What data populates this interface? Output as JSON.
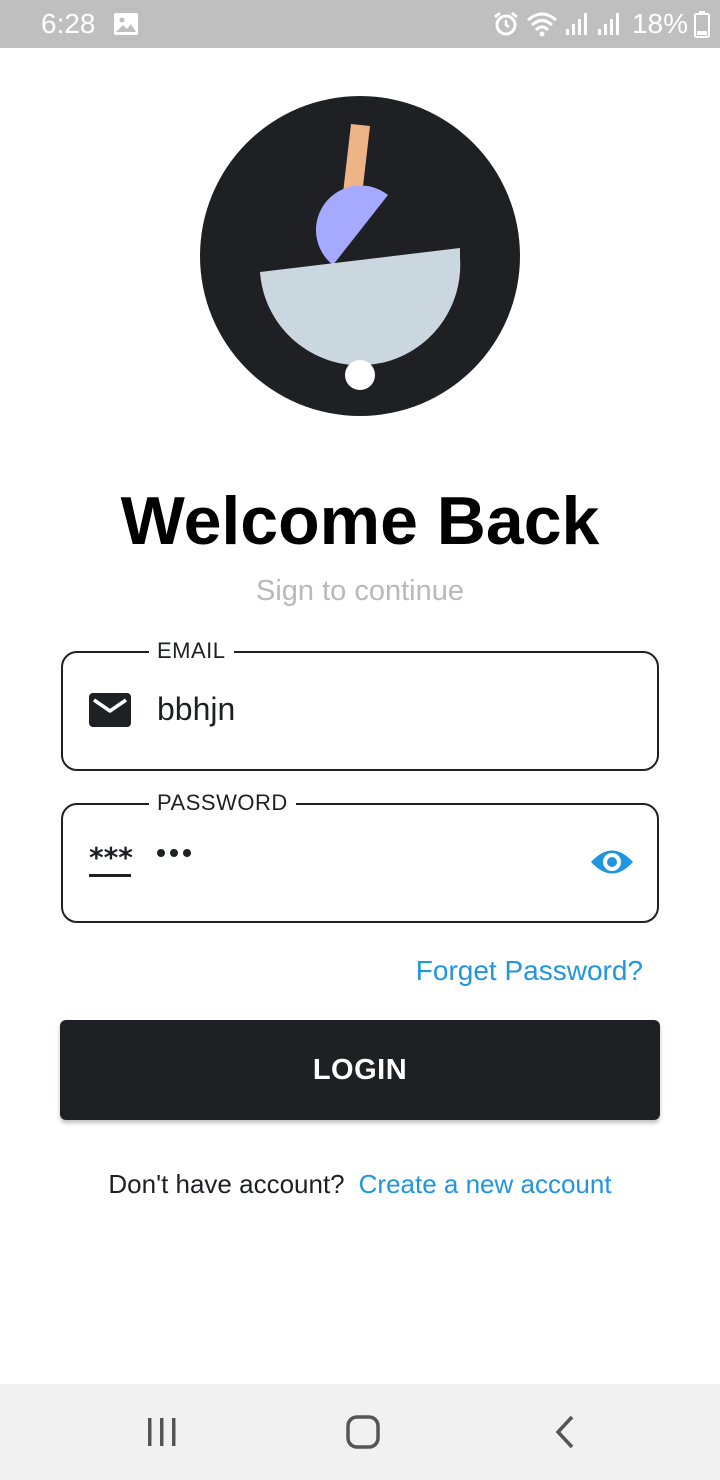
{
  "status_bar": {
    "time": "6:28",
    "battery": "18%",
    "icons": [
      "gallery-icon",
      "alarm-icon",
      "wifi-icon",
      "signal-icon",
      "signal-icon",
      "battery-icon"
    ]
  },
  "logo": {
    "icon": "bowl-spoon-logo",
    "colors": {
      "circle": "#1f2024",
      "handle": "#efb388",
      "scoop": "#a5a9ff",
      "bowl": "#cbd7df",
      "dot": "#ffffff"
    }
  },
  "title": "Welcome Back",
  "subtitle": "Sign to continue",
  "email": {
    "label": "EMAIL",
    "value": "bbhjn",
    "icon": "email-icon"
  },
  "password": {
    "label": "PASSWORD",
    "value": "•••",
    "icon": "password-icon",
    "toggle_icon": "eye-icon"
  },
  "forgot_password": "Forget Password?",
  "login_button": "LOGIN",
  "signup": {
    "text": "Don't have account?",
    "link": "Create a new account"
  },
  "colors": {
    "primary": "#1f2024",
    "link": "#2196e0",
    "muted": "#b9b9b9"
  },
  "nav_bar": {
    "icons": [
      "recents-icon",
      "home-icon",
      "back-icon"
    ]
  }
}
